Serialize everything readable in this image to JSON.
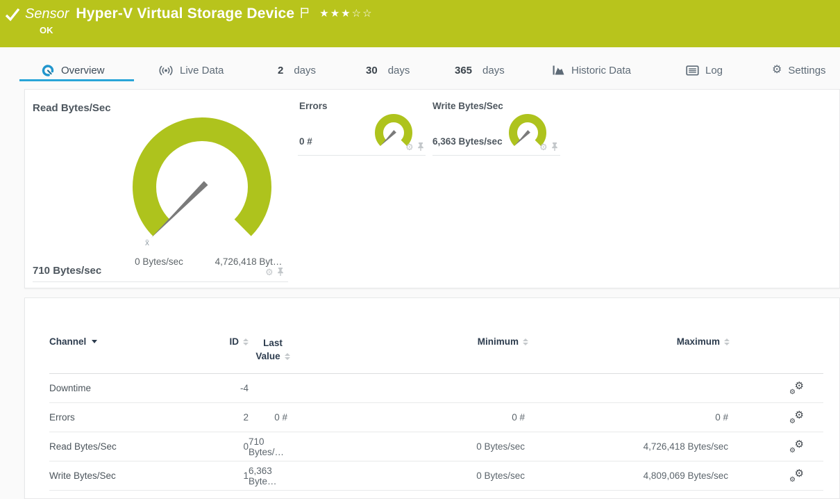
{
  "header": {
    "type_label": "Sensor",
    "title": "Hyper-V Virtual Storage Device",
    "status": "OK",
    "priority": {
      "filled": 3,
      "total": 5,
      "filled_stars": "★★★",
      "empty_stars": "☆☆"
    },
    "colors": {
      "bg": "#b8c41c",
      "fg": "#ffffff"
    }
  },
  "tabs": {
    "overview": {
      "label": "Overview",
      "active": true
    },
    "live_data": {
      "label": "Live Data"
    },
    "days2": {
      "num": "2",
      "unit": "days"
    },
    "days30": {
      "num": "30",
      "unit": "days"
    },
    "days365": {
      "num": "365",
      "unit": "days"
    },
    "historic": {
      "label": "Historic Data"
    },
    "log": {
      "label": "Log"
    },
    "settings": {
      "label": "Settings"
    }
  },
  "gauges": {
    "color": "#aec31d",
    "needle_color": "#7a7a7a",
    "read": {
      "name": "Read Bytes/Sec",
      "value": "710 Bytes/sec",
      "min": "0 Bytes/sec",
      "max": "4,726,418 Byt…",
      "avg_marker": "x̄"
    },
    "errors": {
      "name": "Errors",
      "value": "0 #"
    },
    "write": {
      "name": "Write Bytes/Sec",
      "value": "6,363 Bytes/sec"
    }
  },
  "channel_table": {
    "headers": {
      "channel": "Channel",
      "id": "ID",
      "last_line1": "Last",
      "last_line2": "Value",
      "minimum": "Minimum",
      "maximum": "Maximum"
    },
    "rows": [
      {
        "channel": "Downtime",
        "id": "-4",
        "last": "",
        "min": "",
        "max": ""
      },
      {
        "channel": "Errors",
        "id": "2",
        "last": "0 #",
        "min": "0 #",
        "max": "0 #"
      },
      {
        "channel": "Read Bytes/Sec",
        "id": "0",
        "last": "710 Bytes/…",
        "min": "0 Bytes/sec",
        "max": "4,726,418 Bytes/sec"
      },
      {
        "channel": "Write Bytes/Sec",
        "id": "1",
        "last": "6,363 Byte…",
        "min": "0 Bytes/sec",
        "max": "4,809,069 Bytes/sec"
      }
    ]
  },
  "icons": {
    "gear_glyph": "⚙"
  }
}
